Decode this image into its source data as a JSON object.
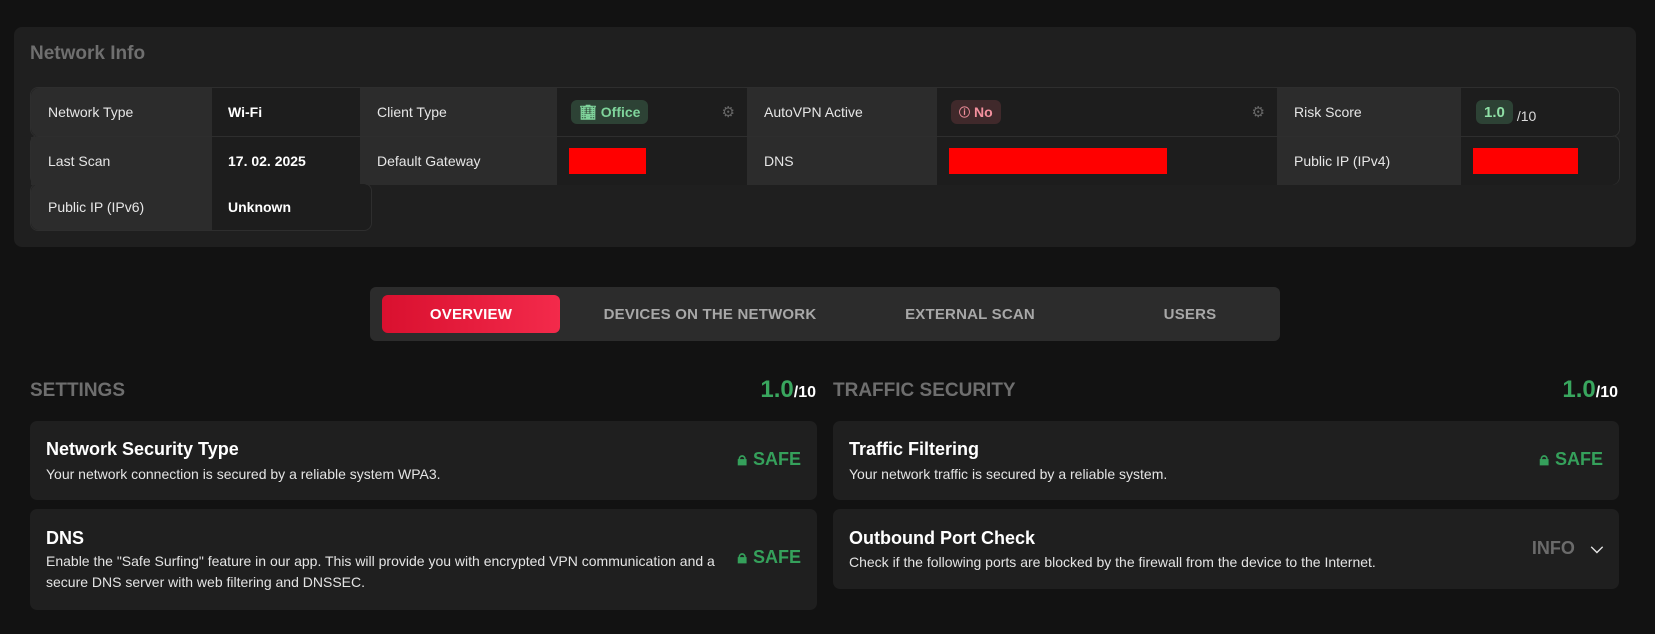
{
  "network_info": {
    "title": "Network Info",
    "rows": [
      {
        "label": "Network Type",
        "value": "Wi-Fi"
      },
      {
        "label": "Client Type",
        "badge": "Office",
        "badge_icon": "building-icon",
        "has_settings": true
      },
      {
        "label": "AutoVPN Active",
        "badge": "No",
        "badge_icon": "info-circle-icon",
        "has_settings": true
      },
      {
        "label": "Risk Score",
        "score": "1.0",
        "score_max": "/10"
      },
      {
        "label": "Last Scan",
        "value": "17. 02. 2025"
      },
      {
        "label": "Default Gateway",
        "value_redacted": true
      },
      {
        "label": "DNS",
        "value_redacted": true
      },
      {
        "label": "Public IP (IPv4)",
        "value_redacted": true
      },
      {
        "label": "Public IP (IPv6)",
        "value": "Unknown"
      }
    ]
  },
  "tabs": [
    {
      "label": "OVERVIEW",
      "active": true
    },
    {
      "label": "DEVICES ON THE NETWORK",
      "active": false
    },
    {
      "label": "EXTERNAL SCAN",
      "active": false
    },
    {
      "label": "USERS",
      "active": false
    }
  ],
  "settings": {
    "title": "SETTINGS",
    "score": "1.0",
    "score_max": "/10",
    "items": [
      {
        "title": "Network Security Type",
        "desc": "Your network connection is secured by a reliable system WPA3.",
        "status": "SAFE"
      },
      {
        "title": "DNS",
        "desc": "Enable the \"Safe Surfing\" feature in our app. This will provide you with encrypted VPN communication and a secure DNS server with web filtering and DNSSEC.",
        "status": "SAFE"
      }
    ]
  },
  "traffic": {
    "title": "TRAFFIC SECURITY",
    "score": "1.0",
    "score_max": "/10",
    "items": [
      {
        "title": "Traffic Filtering",
        "desc": "Your network traffic is secured by a reliable system.",
        "status": "SAFE"
      },
      {
        "title": "Outbound Port Check",
        "desc": "Check if the following ports are blocked by the firewall from the device to the Internet.",
        "status": "INFO"
      }
    ]
  },
  "colors": {
    "accent": "#e8193a",
    "safe": "#35a05b",
    "office_badge": "#7fd49b",
    "no_badge": "#f4909e",
    "redaction": "#ff0000"
  }
}
